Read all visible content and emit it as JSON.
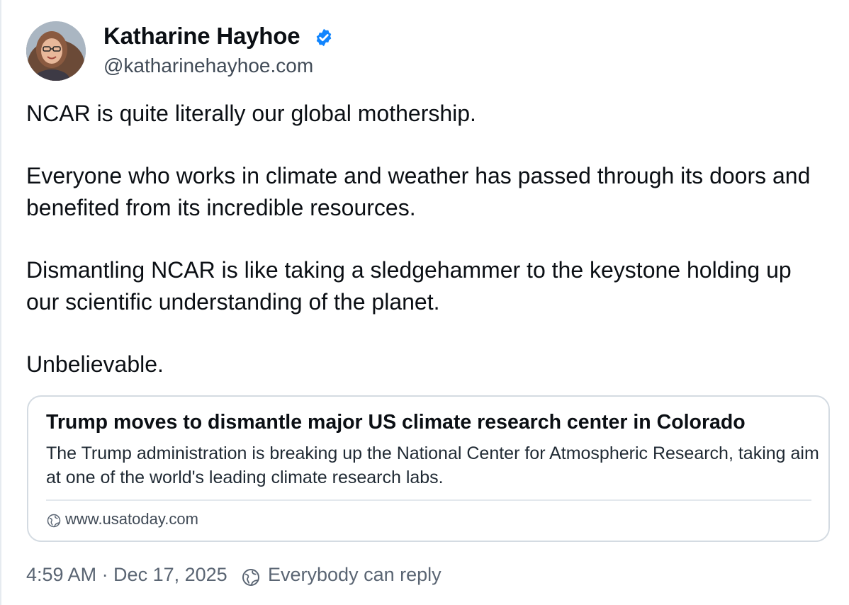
{
  "author": {
    "display_name": "Katharine Hayhoe",
    "handle": "@katharinehayhoe.com",
    "verified": true,
    "verified_color": "#1185fe"
  },
  "post": {
    "paragraphs": [
      "NCAR is quite literally our global mothership.",
      "Everyone who works in climate and weather has passed through its doors and benefited from its incredible resources.",
      "Dismantling NCAR is like taking a sledgehammer to the keystone holding up our scientific understanding of the planet.",
      "Unbelievable."
    ]
  },
  "link_card": {
    "title": "Trump moves to dismantle major US climate research center in Colorado",
    "description": "The Trump administration is breaking up the National Center for Atmospheric Research, taking aim at one of the world's leading climate research labs.",
    "domain": "www.usatoday.com",
    "domain_icon": "globe-icon"
  },
  "footer": {
    "timestamp": "4:59 AM · Dec 17, 2025",
    "reply_icon": "globe-icon",
    "reply_setting": "Everybody can reply"
  },
  "colors": {
    "text_primary": "#0b0f14",
    "text_secondary": "#5a6573",
    "border": "#d4dbe2"
  }
}
